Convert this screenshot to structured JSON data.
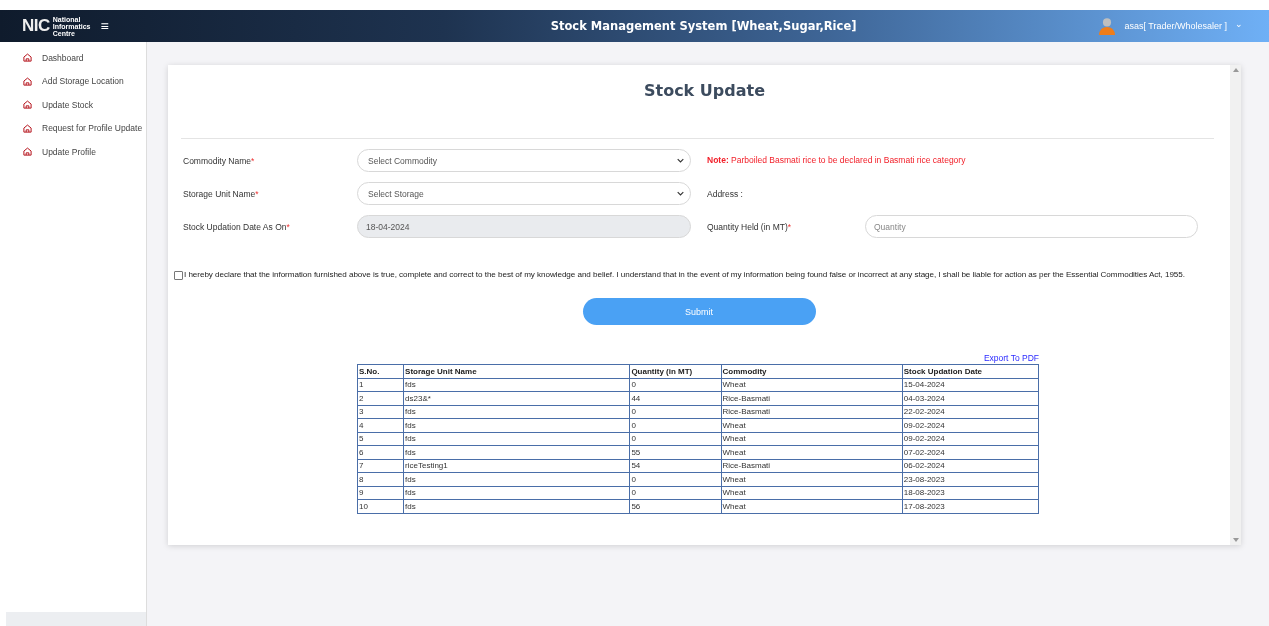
{
  "header": {
    "logo_mark": "NIC",
    "logo_text": [
      "National",
      "Informatics",
      "Centre"
    ],
    "menu_glyph": "≡",
    "title": "Stock Management System [Wheat,Sugar,Rice]",
    "user": "asas[ Trader/Wholesaler ]",
    "caret": "⌄"
  },
  "sidebar": {
    "items": [
      {
        "label": "Dashboard"
      },
      {
        "label": "Add Storage Location"
      },
      {
        "label": "Update Stock"
      },
      {
        "label": "Request for Profile Update"
      },
      {
        "label": "Update Profile"
      }
    ]
  },
  "page_title": "Stock Update",
  "form": {
    "commodity": {
      "label": "Commodity Name",
      "required_mark": "*",
      "placeholder": "Select Commodity"
    },
    "note": {
      "prefix": "Note:",
      "text": "Parboiled Basmati rice to be declared in Basmati rice category"
    },
    "storage": {
      "label": "Storage Unit Name",
      "required_mark": "*",
      "placeholder": "Select Storage"
    },
    "address": {
      "label": "Address :"
    },
    "date": {
      "label": "Stock Updation Date As On",
      "required_mark": "*",
      "value": "18-04-2024",
      "disabled": true
    },
    "quantity": {
      "label": "Quantity Held (in MT)",
      "required_mark": "*",
      "placeholder": "Quantity"
    }
  },
  "declaration": {
    "checked": false,
    "text": "I hereby declare that the information furnished above is true, complete and correct to the best of my knowledge and belief. I understand that in the event of my information being found false or incorrect at any stage, I shall be liable for action as per the Essential Commodities Act, 1955."
  },
  "submit": "Submit",
  "export_link": "Export To PDF",
  "table": {
    "columns": [
      "S.No.",
      "Storage Unit Name",
      "Quantity (in MT)",
      "Commodity",
      "Stock Updation Date"
    ],
    "rows": [
      [
        "1",
        "fds",
        "0",
        "Wheat",
        "15-04-2024"
      ],
      [
        "2",
        "ds23&*",
        "44",
        "Rice-Basmati",
        "04-03-2024"
      ],
      [
        "3",
        "fds",
        "0",
        "Rice-Basmati",
        "22-02-2024"
      ],
      [
        "4",
        "fds",
        "0",
        "Wheat",
        "09-02-2024"
      ],
      [
        "5",
        "fds",
        "0",
        "Wheat",
        "09-02-2024"
      ],
      [
        "6",
        "fds",
        "55",
        "Wheat",
        "07-02-2024"
      ],
      [
        "7",
        "riceTesting1",
        "54",
        "Rice-Basmati",
        "06-02-2024"
      ],
      [
        "8",
        "fds",
        "0",
        "Wheat",
        "23-08-2023"
      ],
      [
        "9",
        "fds",
        "0",
        "Wheat",
        "18-08-2023"
      ],
      [
        "10",
        "fds",
        "56",
        "Wheat",
        "17-08-2023"
      ]
    ]
  }
}
